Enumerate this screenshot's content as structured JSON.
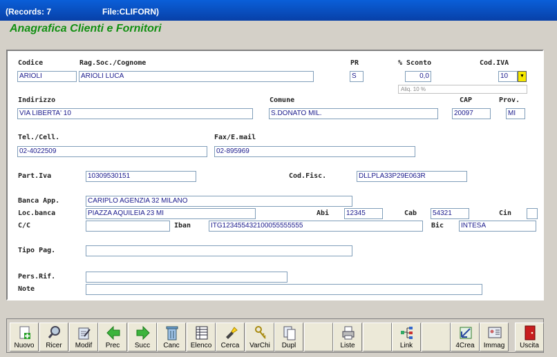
{
  "window": {
    "records": "(Records: 7",
    "file": "File:CLIFORN)"
  },
  "form_title": "Anagrafica Clienti e Fornitori",
  "labels": {
    "codice": "Codice",
    "rag_soc": "Rag.Soc./Cognome",
    "pr": "PR",
    "sconto": "% Sconto",
    "cod_iva": "Cod.IVA",
    "indirizzo": "Indirizzo",
    "comune": "Comune",
    "cap": "CAP",
    "prov": "Prov.",
    "tel": "Tel./Cell.",
    "fax": "Fax/E.mail",
    "piva": "Part.Iva",
    "cod_fisc": "Cod.Fisc.",
    "banca": "Banca App.",
    "loc_banca": "Loc.banca",
    "abi": "Abi",
    "cab": "Cab",
    "cin": "Cin",
    "cc": "C/C",
    "iban": "Iban",
    "bic": "Bic",
    "tipo_pag": "Tipo Pag.",
    "pers_rif": "Pers.Rif.",
    "note": "Note"
  },
  "values": {
    "codice": "ARIOLI",
    "rag_soc": "ARIOLI LUCA",
    "pr": "S",
    "sconto": "0,0",
    "cod_iva": "10",
    "aliquota": "Aliq. 10 %",
    "indirizzo": "VIA LIBERTA' 10",
    "comune": "S.DONATO MIL.",
    "cap": "20097",
    "prov": "MI",
    "tel": "02-4022509",
    "fax": "02-895969",
    "piva": "10309530151",
    "cod_fisc": "DLLPLA33P29E063R",
    "banca": "CARIPLO AGENZIA 32 MILANO",
    "loc_banca": "PIAZZA AQUILEIA 23  MI",
    "abi": "12345",
    "cab": "54321",
    "cin": "",
    "cc": "",
    "iban": "ITG123455432100055555555",
    "bic": "INTESA",
    "tipo_pag": "",
    "pers_rif": "",
    "note": ""
  },
  "toolbar": [
    {
      "label": "Nuovo",
      "icon": "new-document-icon"
    },
    {
      "label": "Ricer",
      "icon": "magnifier-icon"
    },
    {
      "label": "Modif",
      "icon": "edit-icon"
    },
    {
      "label": "Prec",
      "icon": "arrow-left-icon"
    },
    {
      "label": "Succ",
      "icon": "arrow-right-icon"
    },
    {
      "label": "Canc",
      "icon": "trash-icon"
    },
    {
      "label": "Elenco",
      "icon": "list-icon"
    },
    {
      "label": "Cerca",
      "icon": "flashlight-icon"
    },
    {
      "label": "VarChi",
      "icon": "keys-icon"
    },
    {
      "label": "Dupl",
      "icon": "duplicate-icon"
    },
    {
      "label": "",
      "icon": ""
    },
    {
      "label": "Liste",
      "icon": "printer-icon"
    },
    {
      "label": "",
      "icon": ""
    },
    {
      "label": "Link",
      "icon": "link-tree-icon"
    },
    {
      "label": "",
      "icon": ""
    },
    {
      "label": "4Crea",
      "icon": "create-icon"
    },
    {
      "label": "Immag",
      "icon": "image-card-icon"
    },
    {
      "label": "",
      "icon": ""
    },
    {
      "label": "Uscita",
      "icon": "exit-door-icon"
    }
  ],
  "colors": {
    "title_bar": "#0a5fd8",
    "form_title": "#118f11",
    "field_text": "#1a1a8c",
    "dropdown": "#f5e800"
  }
}
